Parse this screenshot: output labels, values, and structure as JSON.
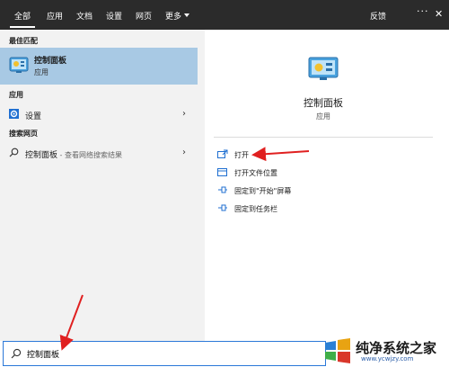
{
  "tabs": [
    {
      "label": "全部"
    },
    {
      "label": "应用"
    },
    {
      "label": "文档"
    },
    {
      "label": "设置"
    },
    {
      "label": "网页"
    },
    {
      "label": "更多"
    }
  ],
  "feedback_label": "反馈",
  "left": {
    "best_match_heading": "最佳匹配",
    "best_match": {
      "title": "控制面板",
      "subtitle": "应用",
      "icon": "control-panel-icon"
    },
    "apps_heading": "应用",
    "apps": [
      {
        "label": "设置",
        "icon": "gear-icon"
      }
    ],
    "web_heading": "搜索网页",
    "web": [
      {
        "label": "控制面板",
        "suffix": " - 查看网络搜索结果",
        "icon": "search-icon"
      }
    ]
  },
  "right": {
    "title": "控制面板",
    "subtitle": "应用",
    "actions": [
      {
        "label": "打开",
        "icon": "open-icon"
      },
      {
        "label": "打开文件位置",
        "icon": "folder-location-icon"
      },
      {
        "label": "固定到\"开始\"屏幕",
        "icon": "pin-icon"
      },
      {
        "label": "固定到任务栏",
        "icon": "pin-icon"
      }
    ]
  },
  "search": {
    "value": "控制面板",
    "placeholder": ""
  },
  "watermark": {
    "main": "纯净系统之家",
    "sub": "www.ycwjzy.com"
  },
  "colors": {
    "topbar": "#2b2b2b",
    "selected": "#a8c9e4",
    "accent": "#2b78d8",
    "annotation": "#e02020"
  }
}
